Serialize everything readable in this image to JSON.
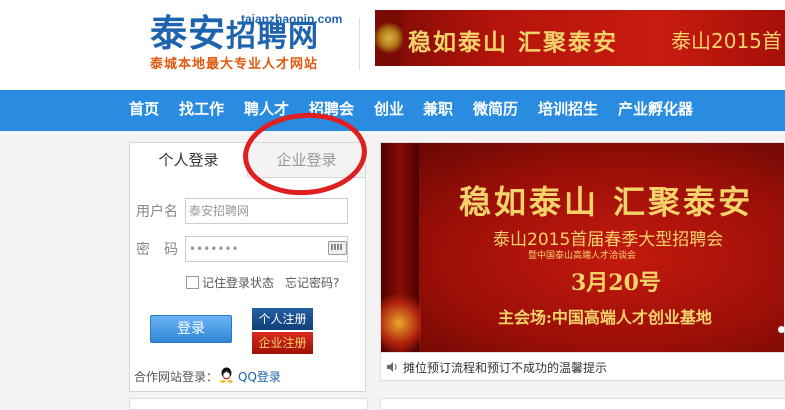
{
  "header": {
    "logo_part1": "泰安",
    "logo_part2": "招聘网",
    "logo_domain": "taianzhaopin.com",
    "logo_slogan": "泰城本地最大专业人才网站",
    "banner_text": "稳如泰山 汇聚泰安",
    "banner_text2": "泰山2015首"
  },
  "nav": {
    "items": [
      {
        "label": "首页"
      },
      {
        "label": "找工作"
      },
      {
        "label": "聘人才"
      },
      {
        "label": "招聘会"
      },
      {
        "label": "创业"
      },
      {
        "label": "兼职"
      },
      {
        "label": "微简历"
      },
      {
        "label": "培训招生"
      },
      {
        "label": "产业孵化器"
      }
    ]
  },
  "login": {
    "tab_personal": "个人登录",
    "tab_company": "企业登录",
    "username_label": "用户名",
    "username_value": "泰安招聘网",
    "password_label": "密　码",
    "password_value": "•••••••",
    "remember_label": "记住登录状态",
    "forgot_label": "忘记密码?",
    "login_button": "登录",
    "register_personal": "个人注册",
    "register_company": "企业注册",
    "partner_label": "合作网站登录：",
    "qq_login": "QQ登录"
  },
  "banner": {
    "title": "稳如泰山 汇聚泰安",
    "subtitle": "泰山2015首届春季大型招聘会",
    "subtitle2": "暨中国泰山高端人才洽谈会",
    "date": "3月20号",
    "venue": "主会场:中国高端人才创业基地"
  },
  "notice": {
    "text": "摊位预订流程和预订不成功的温馨提示"
  },
  "colors": {
    "brand_blue": "#1d63ae",
    "nav_blue": "#2a8ce0",
    "annotation_red": "#e02020",
    "banner_red": "#b5140b",
    "banner_gold": "#f5d36b"
  }
}
